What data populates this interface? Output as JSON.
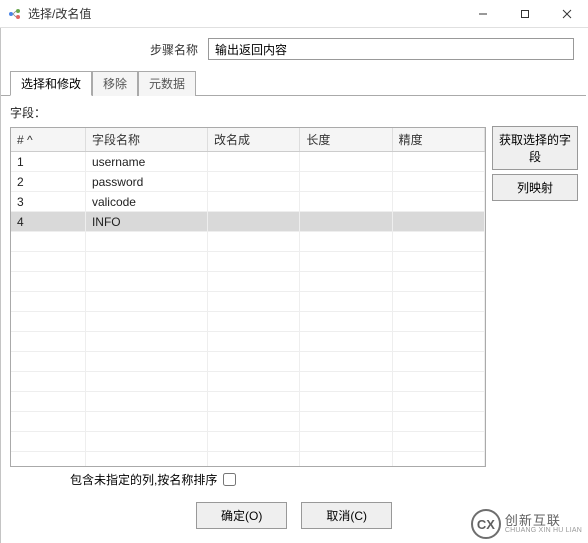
{
  "window": {
    "title": "选择/改名值"
  },
  "form": {
    "step_name_label": "步骤名称",
    "step_name_value": "输出返回内容"
  },
  "tabs": {
    "select_modify": "选择和修改",
    "remove": "移除",
    "metadata": "元数据"
  },
  "section": {
    "fields_label": "字段："
  },
  "table": {
    "headers": {
      "hash": "#",
      "name": "字段名称",
      "rename": "改名成",
      "length": "长度",
      "precision": "精度"
    },
    "rows": [
      {
        "idx": "1",
        "name": "username",
        "rename": "",
        "length": "",
        "precision": ""
      },
      {
        "idx": "2",
        "name": "password",
        "rename": "",
        "length": "",
        "precision": ""
      },
      {
        "idx": "3",
        "name": "valicode",
        "rename": "",
        "length": "",
        "precision": ""
      },
      {
        "idx": "4",
        "name": "INFO",
        "rename": "",
        "length": "",
        "precision": ""
      }
    ]
  },
  "buttons": {
    "get_selected": "获取选择的字段",
    "column_map": "列映射",
    "ok": "确定(O)",
    "cancel": "取消(C)"
  },
  "checkbox": {
    "include_unspecified": "包含未指定的列,按名称排序"
  },
  "watermark": {
    "main": "创新互联",
    "sub": "CHUANG XIN HU LIAN",
    "logo": "CX"
  }
}
